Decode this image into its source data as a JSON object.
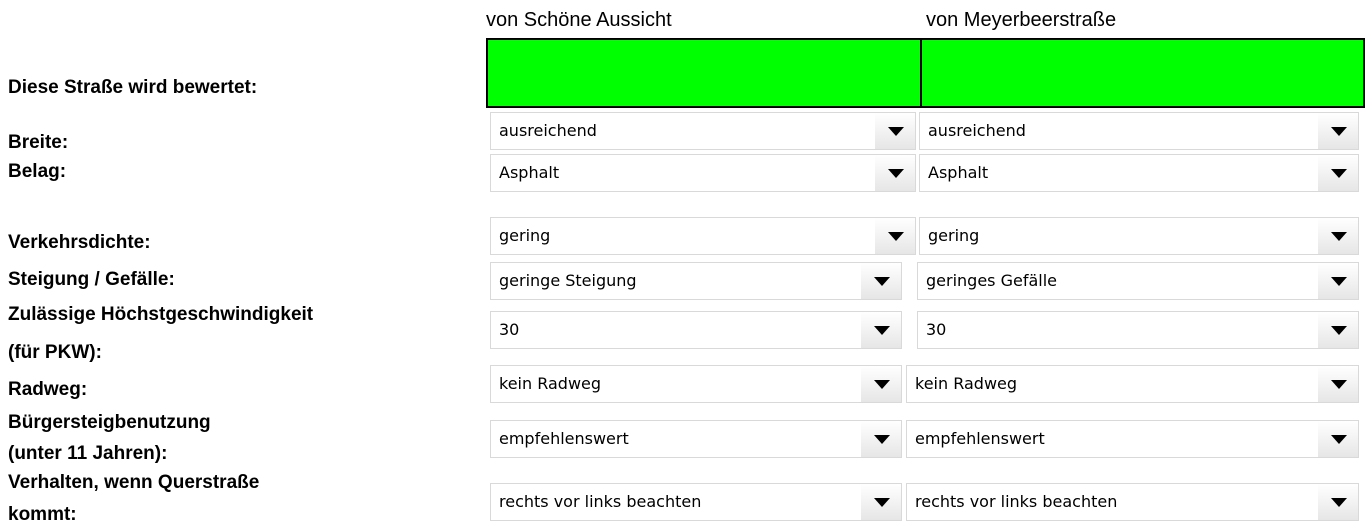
{
  "headers": {
    "col1": "von Schöne Aussicht",
    "col2": "von Meyerbeerstraße"
  },
  "labels": {
    "street": "Diese Straße wird bewertet:",
    "width": "Breite:",
    "surface": "Belag:",
    "traffic": "Verkehrsdichte:",
    "slope": "Steigung / Gefälle:",
    "speed_line1": "Zulässige Höchstgeschwindigkeit",
    "speed_line2": "(für PKW):",
    "bikelane": "Radweg:",
    "sidewalk_line1": "Bürgersteigbenutzung",
    "sidewalk_line2": "(unter 11 Jahren):",
    "crossing_line1": "Verhalten, wenn Querstraße",
    "crossing_line2": "kommt:"
  },
  "col1": {
    "width": "ausreichend",
    "surface": "Asphalt",
    "traffic": "gering",
    "slope": "geringe Steigung",
    "speed": "30",
    "bikelane": "kein Radweg",
    "sidewalk": "empfehlenswert",
    "crossing": "rechts vor links beachten"
  },
  "col2": {
    "width": "ausreichend",
    "surface": "Asphalt",
    "traffic": "gering",
    "slope": "geringes Gefälle",
    "speed": "30",
    "bikelane": "kein Radweg",
    "sidewalk": "empfehlenswert",
    "crossing": "rechts vor links beachten"
  },
  "colors": {
    "street_fill": "#00ff00"
  },
  "icons": {
    "dropdown": "chevron-down-icon"
  }
}
